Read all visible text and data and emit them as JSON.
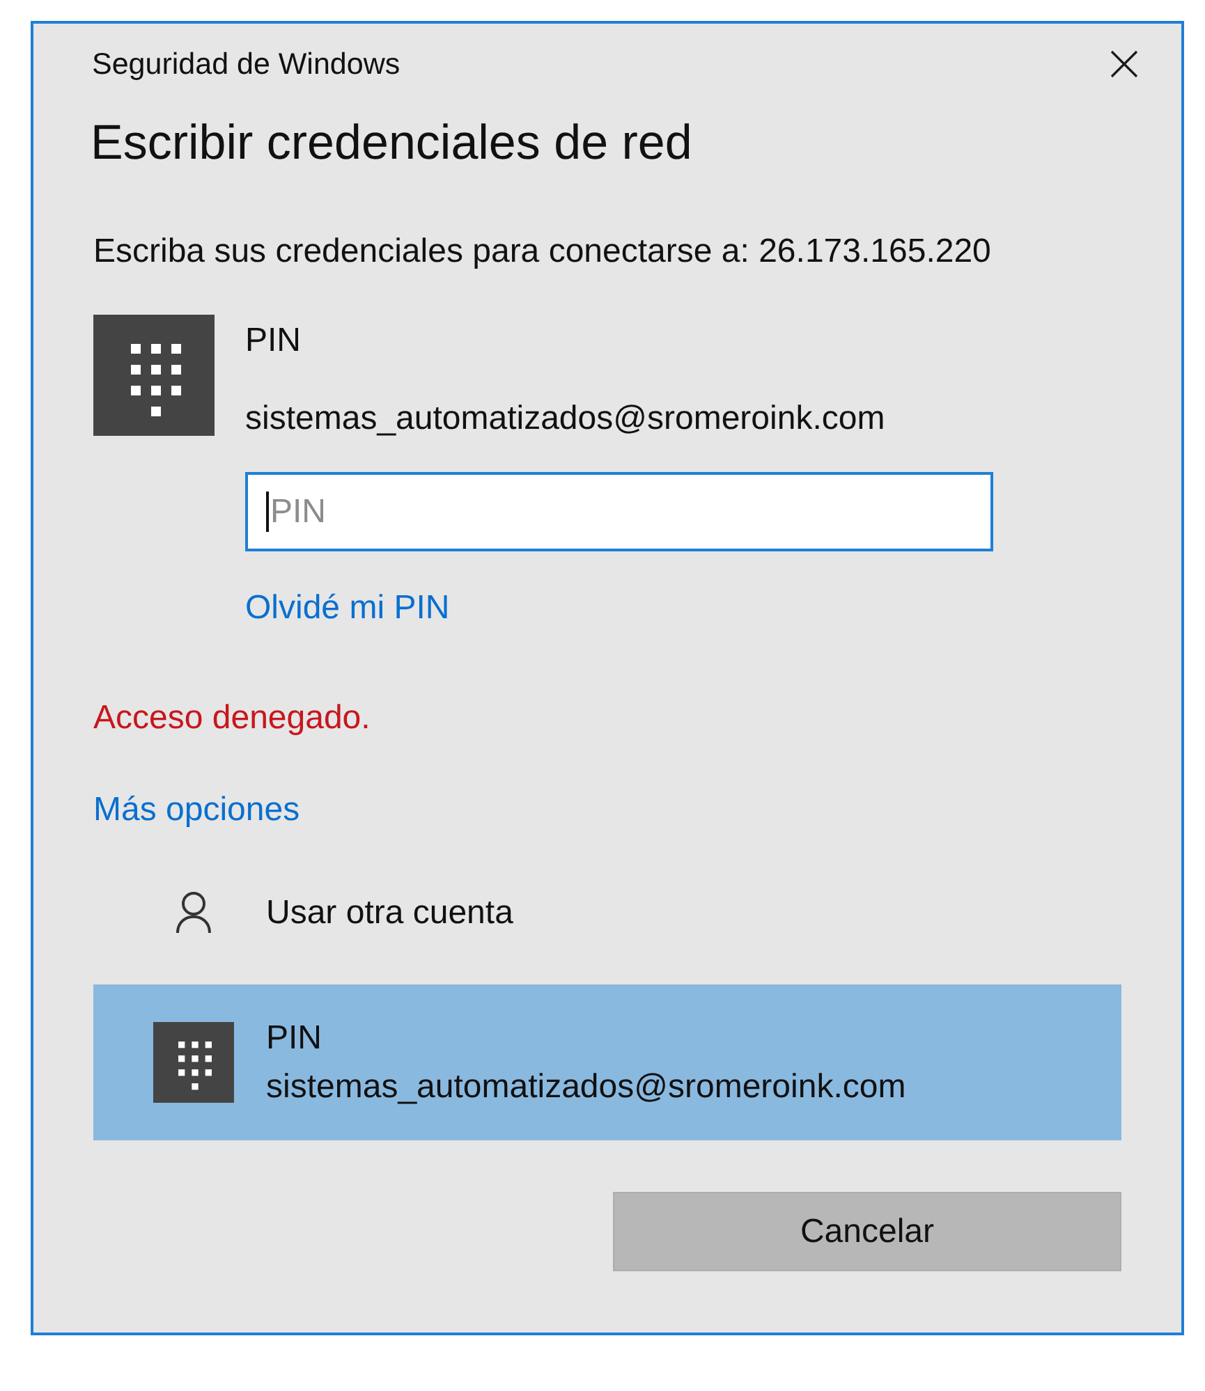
{
  "window": {
    "title": "Seguridad de Windows"
  },
  "heading": "Escribir credenciales de red",
  "prompt": "Escriba sus credenciales para conectarse a: 26.173.165.220",
  "credential": {
    "kind": "pin",
    "label": "PIN",
    "account": "sistemas_automatizados@sromeroink.com",
    "field": {
      "placeholder": "PIN",
      "focused": true
    },
    "link": "Olvidé mi PIN"
  },
  "error": "Acceso denegado.",
  "more_options": "Más opciones",
  "options": [
    {
      "kind": "user",
      "label": "Usar otra cuenta",
      "selected": false
    },
    {
      "kind": "pin",
      "label": "PIN",
      "account": "sistemas_automatizados@sromeroink.com",
      "selected": true
    }
  ],
  "buttons": [
    {
      "label": "Cancelar"
    }
  ]
}
